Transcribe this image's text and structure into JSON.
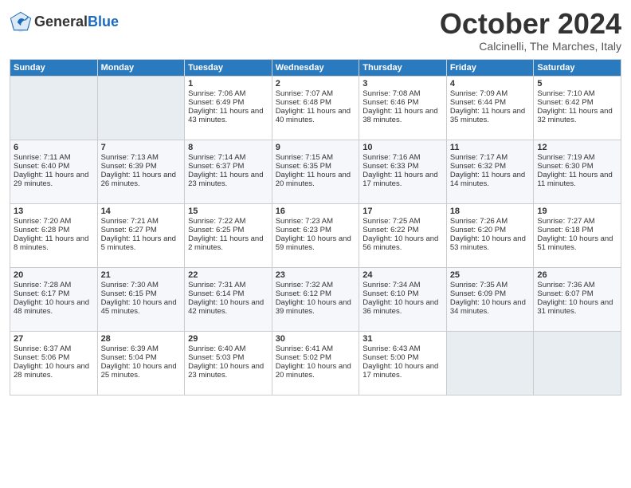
{
  "header": {
    "logo_line1": "General",
    "logo_line2": "Blue",
    "month": "October 2024",
    "location": "Calcinelli, The Marches, Italy"
  },
  "days_of_week": [
    "Sunday",
    "Monday",
    "Tuesday",
    "Wednesday",
    "Thursday",
    "Friday",
    "Saturday"
  ],
  "weeks": [
    [
      {
        "day": "",
        "sunrise": "",
        "sunset": "",
        "daylight": ""
      },
      {
        "day": "",
        "sunrise": "",
        "sunset": "",
        "daylight": ""
      },
      {
        "day": "1",
        "sunrise": "Sunrise: 7:06 AM",
        "sunset": "Sunset: 6:49 PM",
        "daylight": "Daylight: 11 hours and 43 minutes."
      },
      {
        "day": "2",
        "sunrise": "Sunrise: 7:07 AM",
        "sunset": "Sunset: 6:48 PM",
        "daylight": "Daylight: 11 hours and 40 minutes."
      },
      {
        "day": "3",
        "sunrise": "Sunrise: 7:08 AM",
        "sunset": "Sunset: 6:46 PM",
        "daylight": "Daylight: 11 hours and 38 minutes."
      },
      {
        "day": "4",
        "sunrise": "Sunrise: 7:09 AM",
        "sunset": "Sunset: 6:44 PM",
        "daylight": "Daylight: 11 hours and 35 minutes."
      },
      {
        "day": "5",
        "sunrise": "Sunrise: 7:10 AM",
        "sunset": "Sunset: 6:42 PM",
        "daylight": "Daylight: 11 hours and 32 minutes."
      }
    ],
    [
      {
        "day": "6",
        "sunrise": "Sunrise: 7:11 AM",
        "sunset": "Sunset: 6:40 PM",
        "daylight": "Daylight: 11 hours and 29 minutes."
      },
      {
        "day": "7",
        "sunrise": "Sunrise: 7:13 AM",
        "sunset": "Sunset: 6:39 PM",
        "daylight": "Daylight: 11 hours and 26 minutes."
      },
      {
        "day": "8",
        "sunrise": "Sunrise: 7:14 AM",
        "sunset": "Sunset: 6:37 PM",
        "daylight": "Daylight: 11 hours and 23 minutes."
      },
      {
        "day": "9",
        "sunrise": "Sunrise: 7:15 AM",
        "sunset": "Sunset: 6:35 PM",
        "daylight": "Daylight: 11 hours and 20 minutes."
      },
      {
        "day": "10",
        "sunrise": "Sunrise: 7:16 AM",
        "sunset": "Sunset: 6:33 PM",
        "daylight": "Daylight: 11 hours and 17 minutes."
      },
      {
        "day": "11",
        "sunrise": "Sunrise: 7:17 AM",
        "sunset": "Sunset: 6:32 PM",
        "daylight": "Daylight: 11 hours and 14 minutes."
      },
      {
        "day": "12",
        "sunrise": "Sunrise: 7:19 AM",
        "sunset": "Sunset: 6:30 PM",
        "daylight": "Daylight: 11 hours and 11 minutes."
      }
    ],
    [
      {
        "day": "13",
        "sunrise": "Sunrise: 7:20 AM",
        "sunset": "Sunset: 6:28 PM",
        "daylight": "Daylight: 11 hours and 8 minutes."
      },
      {
        "day": "14",
        "sunrise": "Sunrise: 7:21 AM",
        "sunset": "Sunset: 6:27 PM",
        "daylight": "Daylight: 11 hours and 5 minutes."
      },
      {
        "day": "15",
        "sunrise": "Sunrise: 7:22 AM",
        "sunset": "Sunset: 6:25 PM",
        "daylight": "Daylight: 11 hours and 2 minutes."
      },
      {
        "day": "16",
        "sunrise": "Sunrise: 7:23 AM",
        "sunset": "Sunset: 6:23 PM",
        "daylight": "Daylight: 10 hours and 59 minutes."
      },
      {
        "day": "17",
        "sunrise": "Sunrise: 7:25 AM",
        "sunset": "Sunset: 6:22 PM",
        "daylight": "Daylight: 10 hours and 56 minutes."
      },
      {
        "day": "18",
        "sunrise": "Sunrise: 7:26 AM",
        "sunset": "Sunset: 6:20 PM",
        "daylight": "Daylight: 10 hours and 53 minutes."
      },
      {
        "day": "19",
        "sunrise": "Sunrise: 7:27 AM",
        "sunset": "Sunset: 6:18 PM",
        "daylight": "Daylight: 10 hours and 51 minutes."
      }
    ],
    [
      {
        "day": "20",
        "sunrise": "Sunrise: 7:28 AM",
        "sunset": "Sunset: 6:17 PM",
        "daylight": "Daylight: 10 hours and 48 minutes."
      },
      {
        "day": "21",
        "sunrise": "Sunrise: 7:30 AM",
        "sunset": "Sunset: 6:15 PM",
        "daylight": "Daylight: 10 hours and 45 minutes."
      },
      {
        "day": "22",
        "sunrise": "Sunrise: 7:31 AM",
        "sunset": "Sunset: 6:14 PM",
        "daylight": "Daylight: 10 hours and 42 minutes."
      },
      {
        "day": "23",
        "sunrise": "Sunrise: 7:32 AM",
        "sunset": "Sunset: 6:12 PM",
        "daylight": "Daylight: 10 hours and 39 minutes."
      },
      {
        "day": "24",
        "sunrise": "Sunrise: 7:34 AM",
        "sunset": "Sunset: 6:10 PM",
        "daylight": "Daylight: 10 hours and 36 minutes."
      },
      {
        "day": "25",
        "sunrise": "Sunrise: 7:35 AM",
        "sunset": "Sunset: 6:09 PM",
        "daylight": "Daylight: 10 hours and 34 minutes."
      },
      {
        "day": "26",
        "sunrise": "Sunrise: 7:36 AM",
        "sunset": "Sunset: 6:07 PM",
        "daylight": "Daylight: 10 hours and 31 minutes."
      }
    ],
    [
      {
        "day": "27",
        "sunrise": "Sunrise: 6:37 AM",
        "sunset": "Sunset: 5:06 PM",
        "daylight": "Daylight: 10 hours and 28 minutes."
      },
      {
        "day": "28",
        "sunrise": "Sunrise: 6:39 AM",
        "sunset": "Sunset: 5:04 PM",
        "daylight": "Daylight: 10 hours and 25 minutes."
      },
      {
        "day": "29",
        "sunrise": "Sunrise: 6:40 AM",
        "sunset": "Sunset: 5:03 PM",
        "daylight": "Daylight: 10 hours and 23 minutes."
      },
      {
        "day": "30",
        "sunrise": "Sunrise: 6:41 AM",
        "sunset": "Sunset: 5:02 PM",
        "daylight": "Daylight: 10 hours and 20 minutes."
      },
      {
        "day": "31",
        "sunrise": "Sunrise: 6:43 AM",
        "sunset": "Sunset: 5:00 PM",
        "daylight": "Daylight: 10 hours and 17 minutes."
      },
      {
        "day": "",
        "sunrise": "",
        "sunset": "",
        "daylight": ""
      },
      {
        "day": "",
        "sunrise": "",
        "sunset": "",
        "daylight": ""
      }
    ]
  ]
}
